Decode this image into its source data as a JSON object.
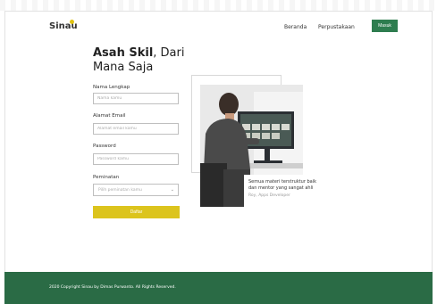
{
  "brand": {
    "logo": "Sinau"
  },
  "nav": {
    "items": [
      {
        "label": "Beranda"
      },
      {
        "label": "Perpustakaan"
      }
    ],
    "login_label": "Masuk"
  },
  "hero": {
    "title_bold": "Asah Skil",
    "title_rest": ", Dari",
    "title_line2": "Mana Saja"
  },
  "form": {
    "name_label": "Nama Lengkap",
    "name_placeholder": "Nama kamu",
    "email_label": "Alamat Email",
    "email_placeholder": "Alamat email kamu",
    "password_label": "Password",
    "password_placeholder": "Password kamu",
    "interest_label": "Peminatan",
    "interest_placeholder": "Pilih peminatan kamu",
    "submit_label": "Daftar"
  },
  "testimonial": {
    "quote": "Semua materi terstruktur baik dan mentor yang sangat ahli",
    "author": "Roy, Apps Developer"
  },
  "footer": {
    "copyright": "2020 Copyright Sinau by Dimas Purwanto. All Rights Reserved."
  },
  "colors": {
    "primary": "#2e7d4f",
    "accent": "#dcc41d",
    "footer": "#2a6b45"
  }
}
